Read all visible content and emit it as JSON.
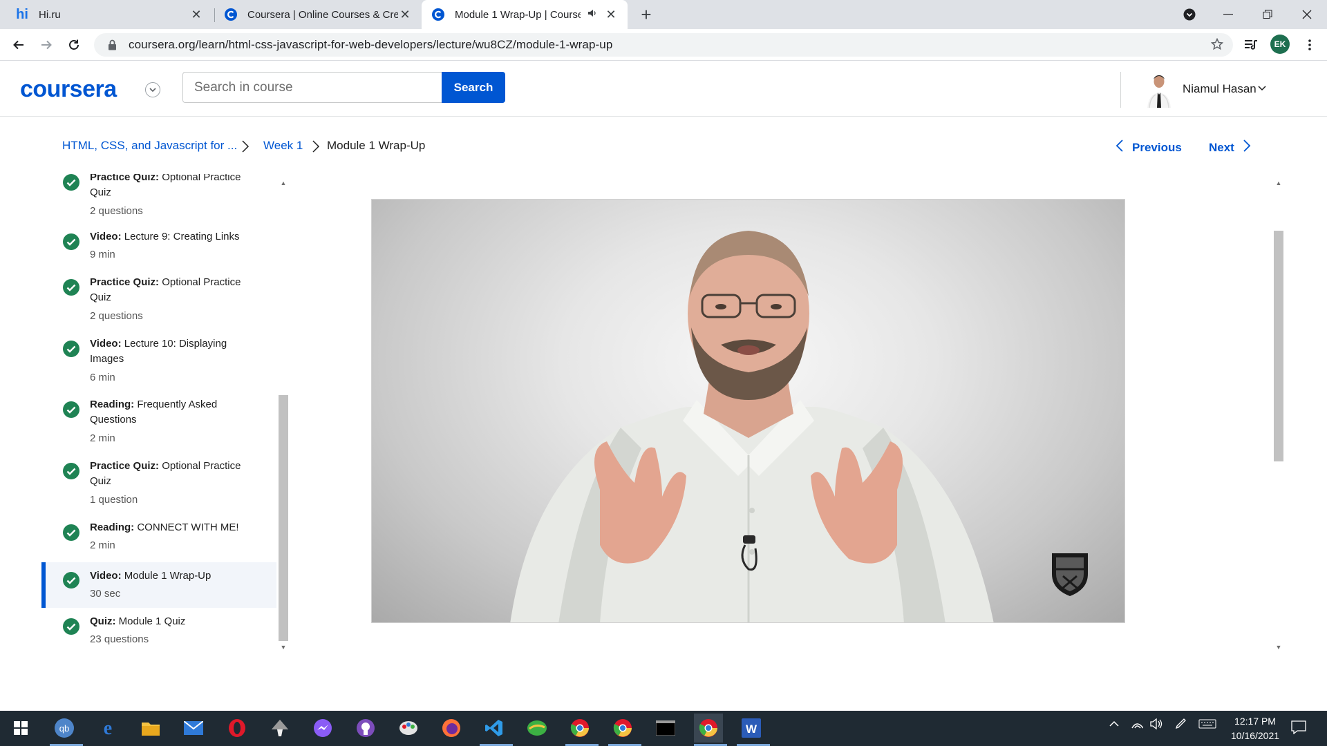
{
  "browser": {
    "tabs": [
      {
        "title": "Hi.ru",
        "favicon": "hi-favicon"
      },
      {
        "title": "Coursera | Online Courses & Credentials",
        "favicon": "coursera-favicon"
      },
      {
        "title": "Module 1 Wrap-Up | Coursera",
        "favicon": "coursera-favicon",
        "active": true,
        "audio": true
      }
    ],
    "url": "coursera.org/learn/html-css-javascript-for-web-developers/lecture/wu8CZ/module-1-wrap-up",
    "profile_initials": "EK"
  },
  "header": {
    "logo": "coursera",
    "search_placeholder": "Search in course",
    "search_button": "Search",
    "user_name": "Niamul Hasan"
  },
  "breadcrumb": {
    "course": "HTML, CSS, and Javascript for ...",
    "week": "Week 1",
    "current": "Module 1 Wrap-Up"
  },
  "pager": {
    "previous": "Previous",
    "next": "Next"
  },
  "sidebar": {
    "items": [
      {
        "type": "Practice Quiz:",
        "title": "Optional Practice Quiz",
        "meta": "2 questions"
      },
      {
        "type": "Video:",
        "title": "Lecture 9: Creating Links",
        "meta": "9 min"
      },
      {
        "type": "Practice Quiz:",
        "title": "Optional Practice Quiz",
        "meta": "2 questions"
      },
      {
        "type": "Video:",
        "title": "Lecture 10: Displaying Images",
        "meta": "6 min"
      },
      {
        "type": "Reading:",
        "title": "Frequently Asked Questions",
        "meta": "2 min"
      },
      {
        "type": "Practice Quiz:",
        "title": "Optional Practice Quiz",
        "meta": "1 question"
      },
      {
        "type": "Reading:",
        "title": "CONNECT WITH ME!",
        "meta": "2 min"
      },
      {
        "type": "Video:",
        "title": "Module 1 Wrap-Up",
        "meta": "30 sec",
        "active": true
      },
      {
        "type": "Quiz:",
        "title": "Module 1 Quiz",
        "meta": "23 questions"
      }
    ]
  },
  "taskbar": {
    "time": "12:17 PM",
    "date": "10/16/2021"
  },
  "colors": {
    "brand": "#0056d2",
    "check": "#1f8354",
    "tabbar": "#dee1e6",
    "taskbar": "#1f2a33"
  }
}
